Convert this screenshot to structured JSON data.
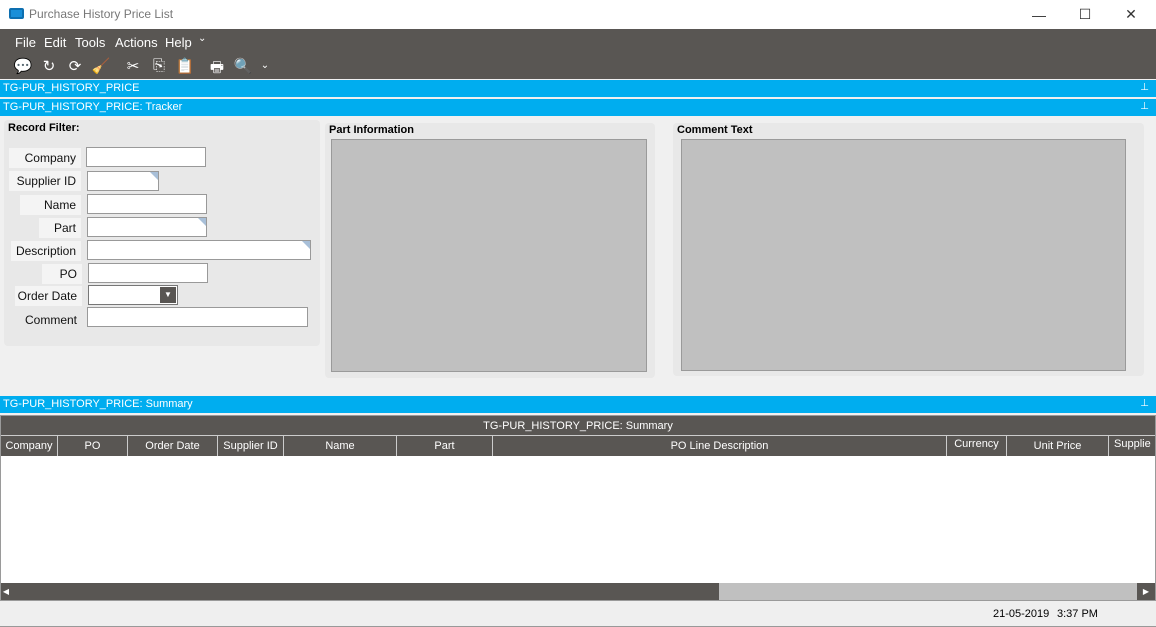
{
  "window": {
    "title": "Purchase History Price List",
    "minimize": "—",
    "maximize": "☐",
    "close": "✕"
  },
  "menu": [
    "File",
    "Edit",
    "Tools",
    "Actions",
    "Help"
  ],
  "menu_overflow": "⌄",
  "toolbar": [
    {
      "icon": "chat-icon",
      "glyph": "💬"
    },
    {
      "icon": "refresh-icon",
      "glyph": "↻"
    },
    {
      "icon": "sync-icon",
      "glyph": "⟳"
    },
    {
      "icon": "clear-broom-icon",
      "glyph": "🧹"
    },
    {
      "icon": "cut-icon",
      "glyph": "✂"
    },
    {
      "icon": "copy-icon",
      "glyph": "⎘"
    },
    {
      "icon": "paste-icon",
      "glyph": "📋"
    },
    {
      "icon": "print-icon",
      "glyph": "🖶"
    },
    {
      "icon": "print-preview-icon",
      "glyph": "🔍"
    }
  ],
  "bars": {
    "main": "TG-PUR_HISTORY_PRICE",
    "tracker": "TG-PUR_HISTORY_PRICE: Tracker",
    "summary": "TG-PUR_HISTORY_PRICE: Summary",
    "pin": "⊥"
  },
  "filter": {
    "title": "Record Filter:",
    "company": "Company",
    "supplier_id": "Supplier ID",
    "name": "Name",
    "part": "Part",
    "description": "Description",
    "po": "PO",
    "order_date": "Order Date",
    "comment": "Comment"
  },
  "part_info": {
    "title": "Part Information"
  },
  "comment_text": {
    "title": "Comment Text"
  },
  "grid": {
    "title": "TG-PUR_HISTORY_PRICE: Summary",
    "columns": [
      "Company",
      "PO",
      "Order Date",
      "Supplier ID",
      "Name",
      "Part",
      "PO Line Description",
      "Currency",
      "Unit Price",
      "Supplie"
    ]
  },
  "status": {
    "date": "21-05-2019",
    "time": "3:37 PM"
  }
}
